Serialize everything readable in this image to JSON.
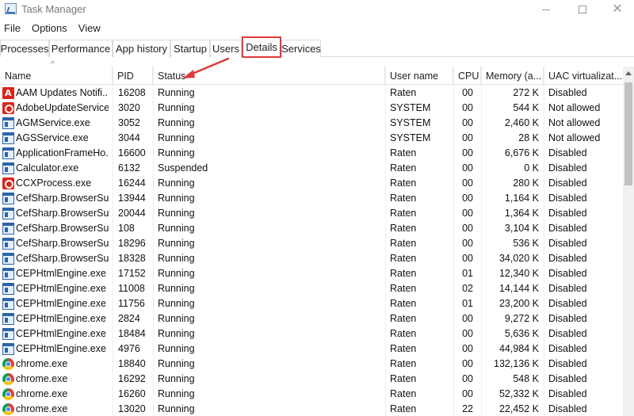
{
  "window": {
    "title": "Task Manager"
  },
  "menu": [
    "File",
    "Options",
    "View"
  ],
  "tabs": [
    "Processes",
    "Performance",
    "App history",
    "Startup",
    "Users",
    "Details",
    "Services"
  ],
  "active_tab": "Details",
  "columns": [
    "Name",
    "PID",
    "Status",
    "User name",
    "CPU",
    "Memory (a...",
    "UAC virtualizat..."
  ],
  "sort_column": "Name",
  "rows": [
    {
      "icon": "adobe-icon",
      "name": "AAM Updates Notifi...",
      "pid": "16208",
      "status": "Running",
      "user": "Raten",
      "cpu": "00",
      "mem": "272 K",
      "uac": "Disabled"
    },
    {
      "icon": "creative-cloud-icon",
      "name": "AdobeUpdateService...",
      "pid": "3020",
      "status": "Running",
      "user": "SYSTEM",
      "cpu": "00",
      "mem": "544 K",
      "uac": "Not allowed"
    },
    {
      "icon": "window-icon",
      "name": "AGMService.exe",
      "pid": "3052",
      "status": "Running",
      "user": "SYSTEM",
      "cpu": "00",
      "mem": "2,460 K",
      "uac": "Not allowed"
    },
    {
      "icon": "window-icon",
      "name": "AGSService.exe",
      "pid": "3044",
      "status": "Running",
      "user": "SYSTEM",
      "cpu": "00",
      "mem": "28 K",
      "uac": "Not allowed"
    },
    {
      "icon": "window-icon",
      "name": "ApplicationFrameHo...",
      "pid": "16600",
      "status": "Running",
      "user": "Raten",
      "cpu": "00",
      "mem": "6,676 K",
      "uac": "Disabled"
    },
    {
      "icon": "window-icon",
      "name": "Calculator.exe",
      "pid": "6132",
      "status": "Suspended",
      "user": "Raten",
      "cpu": "00",
      "mem": "0 K",
      "uac": "Disabled"
    },
    {
      "icon": "creative-cloud-icon",
      "name": "CCXProcess.exe",
      "pid": "16244",
      "status": "Running",
      "user": "Raten",
      "cpu": "00",
      "mem": "280 K",
      "uac": "Disabled"
    },
    {
      "icon": "window-icon",
      "name": "CefSharp.BrowserSu...",
      "pid": "13944",
      "status": "Running",
      "user": "Raten",
      "cpu": "00",
      "mem": "1,164 K",
      "uac": "Disabled"
    },
    {
      "icon": "window-icon",
      "name": "CefSharp.BrowserSu...",
      "pid": "20044",
      "status": "Running",
      "user": "Raten",
      "cpu": "00",
      "mem": "1,364 K",
      "uac": "Disabled"
    },
    {
      "icon": "window-icon",
      "name": "CefSharp.BrowserSu...",
      "pid": "108",
      "status": "Running",
      "user": "Raten",
      "cpu": "00",
      "mem": "3,104 K",
      "uac": "Disabled"
    },
    {
      "icon": "window-icon",
      "name": "CefSharp.BrowserSu...",
      "pid": "18296",
      "status": "Running",
      "user": "Raten",
      "cpu": "00",
      "mem": "536 K",
      "uac": "Disabled"
    },
    {
      "icon": "window-icon",
      "name": "CefSharp.BrowserSu...",
      "pid": "18328",
      "status": "Running",
      "user": "Raten",
      "cpu": "00",
      "mem": "34,020 K",
      "uac": "Disabled"
    },
    {
      "icon": "window-icon",
      "name": "CEPHtmlEngine.exe",
      "pid": "17152",
      "status": "Running",
      "user": "Raten",
      "cpu": "01",
      "mem": "12,340 K",
      "uac": "Disabled"
    },
    {
      "icon": "window-icon",
      "name": "CEPHtmlEngine.exe",
      "pid": "11008",
      "status": "Running",
      "user": "Raten",
      "cpu": "02",
      "mem": "14,144 K",
      "uac": "Disabled"
    },
    {
      "icon": "window-icon",
      "name": "CEPHtmlEngine.exe",
      "pid": "11756",
      "status": "Running",
      "user": "Raten",
      "cpu": "01",
      "mem": "23,200 K",
      "uac": "Disabled"
    },
    {
      "icon": "window-icon",
      "name": "CEPHtmlEngine.exe",
      "pid": "2824",
      "status": "Running",
      "user": "Raten",
      "cpu": "00",
      "mem": "9,272 K",
      "uac": "Disabled"
    },
    {
      "icon": "window-icon",
      "name": "CEPHtmlEngine.exe",
      "pid": "18484",
      "status": "Running",
      "user": "Raten",
      "cpu": "00",
      "mem": "5,636 K",
      "uac": "Disabled"
    },
    {
      "icon": "window-icon",
      "name": "CEPHtmlEngine.exe",
      "pid": "4976",
      "status": "Running",
      "user": "Raten",
      "cpu": "00",
      "mem": "44,984 K",
      "uac": "Disabled"
    },
    {
      "icon": "chrome-icon",
      "name": "chrome.exe",
      "pid": "18840",
      "status": "Running",
      "user": "Raten",
      "cpu": "00",
      "mem": "132,136 K",
      "uac": "Disabled"
    },
    {
      "icon": "chrome-icon",
      "name": "chrome.exe",
      "pid": "16292",
      "status": "Running",
      "user": "Raten",
      "cpu": "00",
      "mem": "548 K",
      "uac": "Disabled"
    },
    {
      "icon": "chrome-icon",
      "name": "chrome.exe",
      "pid": "16260",
      "status": "Running",
      "user": "Raten",
      "cpu": "00",
      "mem": "52,332 K",
      "uac": "Disabled"
    },
    {
      "icon": "chrome-icon",
      "name": "chrome.exe",
      "pid": "13020",
      "status": "Running",
      "user": "Raten",
      "cpu": "22",
      "mem": "22,452 K",
      "uac": "Disabled"
    }
  ],
  "colors": {
    "highlight": "#e23a3a",
    "annotation_arrow": "#e23a3a"
  }
}
